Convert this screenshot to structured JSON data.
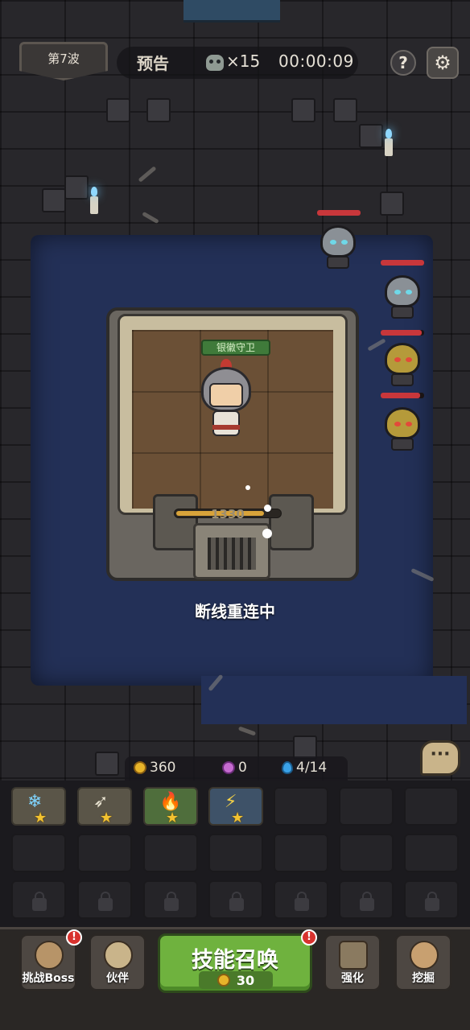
{
  "hud": {
    "wave_label": "第7波",
    "preview_label": "预告",
    "enemy_count": "×15",
    "timer": "00:00:09",
    "help_label": "?",
    "settings_icon": "gear-icon"
  },
  "battle": {
    "hero_name": "银徽守卫",
    "fortress_hp": "1330",
    "fortress_hp_fraction": 0.85,
    "status_message": "断线重连中",
    "enemies": [
      {
        "type": "skeleton-soldier",
        "hp_fraction": 1.0
      },
      {
        "type": "skeleton-soldier",
        "hp_fraction": 1.0
      },
      {
        "type": "gold-helmet-skeleton",
        "hp_fraction": 0.95
      },
      {
        "type": "gold-helmet-skeleton",
        "hp_fraction": 0.9
      }
    ]
  },
  "resources": {
    "gold": "360",
    "gems": "0",
    "energy": "4/14"
  },
  "skills": [
    {
      "name": "ice-shard",
      "stars": 1,
      "glyph": "❄"
    },
    {
      "name": "arrow-volley",
      "stars": 1,
      "glyph": "➶"
    },
    {
      "name": "fire-wings",
      "stars": 1,
      "glyph": "🔥"
    },
    {
      "name": "lightning-arrow",
      "stars": 1,
      "glyph": "⚡"
    }
  ],
  "chat": {
    "icon": "chat-bubble-icon",
    "glyph": "···"
  },
  "nav": {
    "challenge_boss": "挑战Boss",
    "partners": "伙伴",
    "summon": "技能召唤",
    "summon_cost": "30",
    "upgrade": "强化",
    "dig": "挖掘",
    "alert_mark": "!"
  },
  "colors": {
    "summon_green": "#6fb23e",
    "water_blue": "#233057",
    "enemy_hp_red": "#c8373b",
    "hero_tag_green": "#3f7a3a"
  }
}
